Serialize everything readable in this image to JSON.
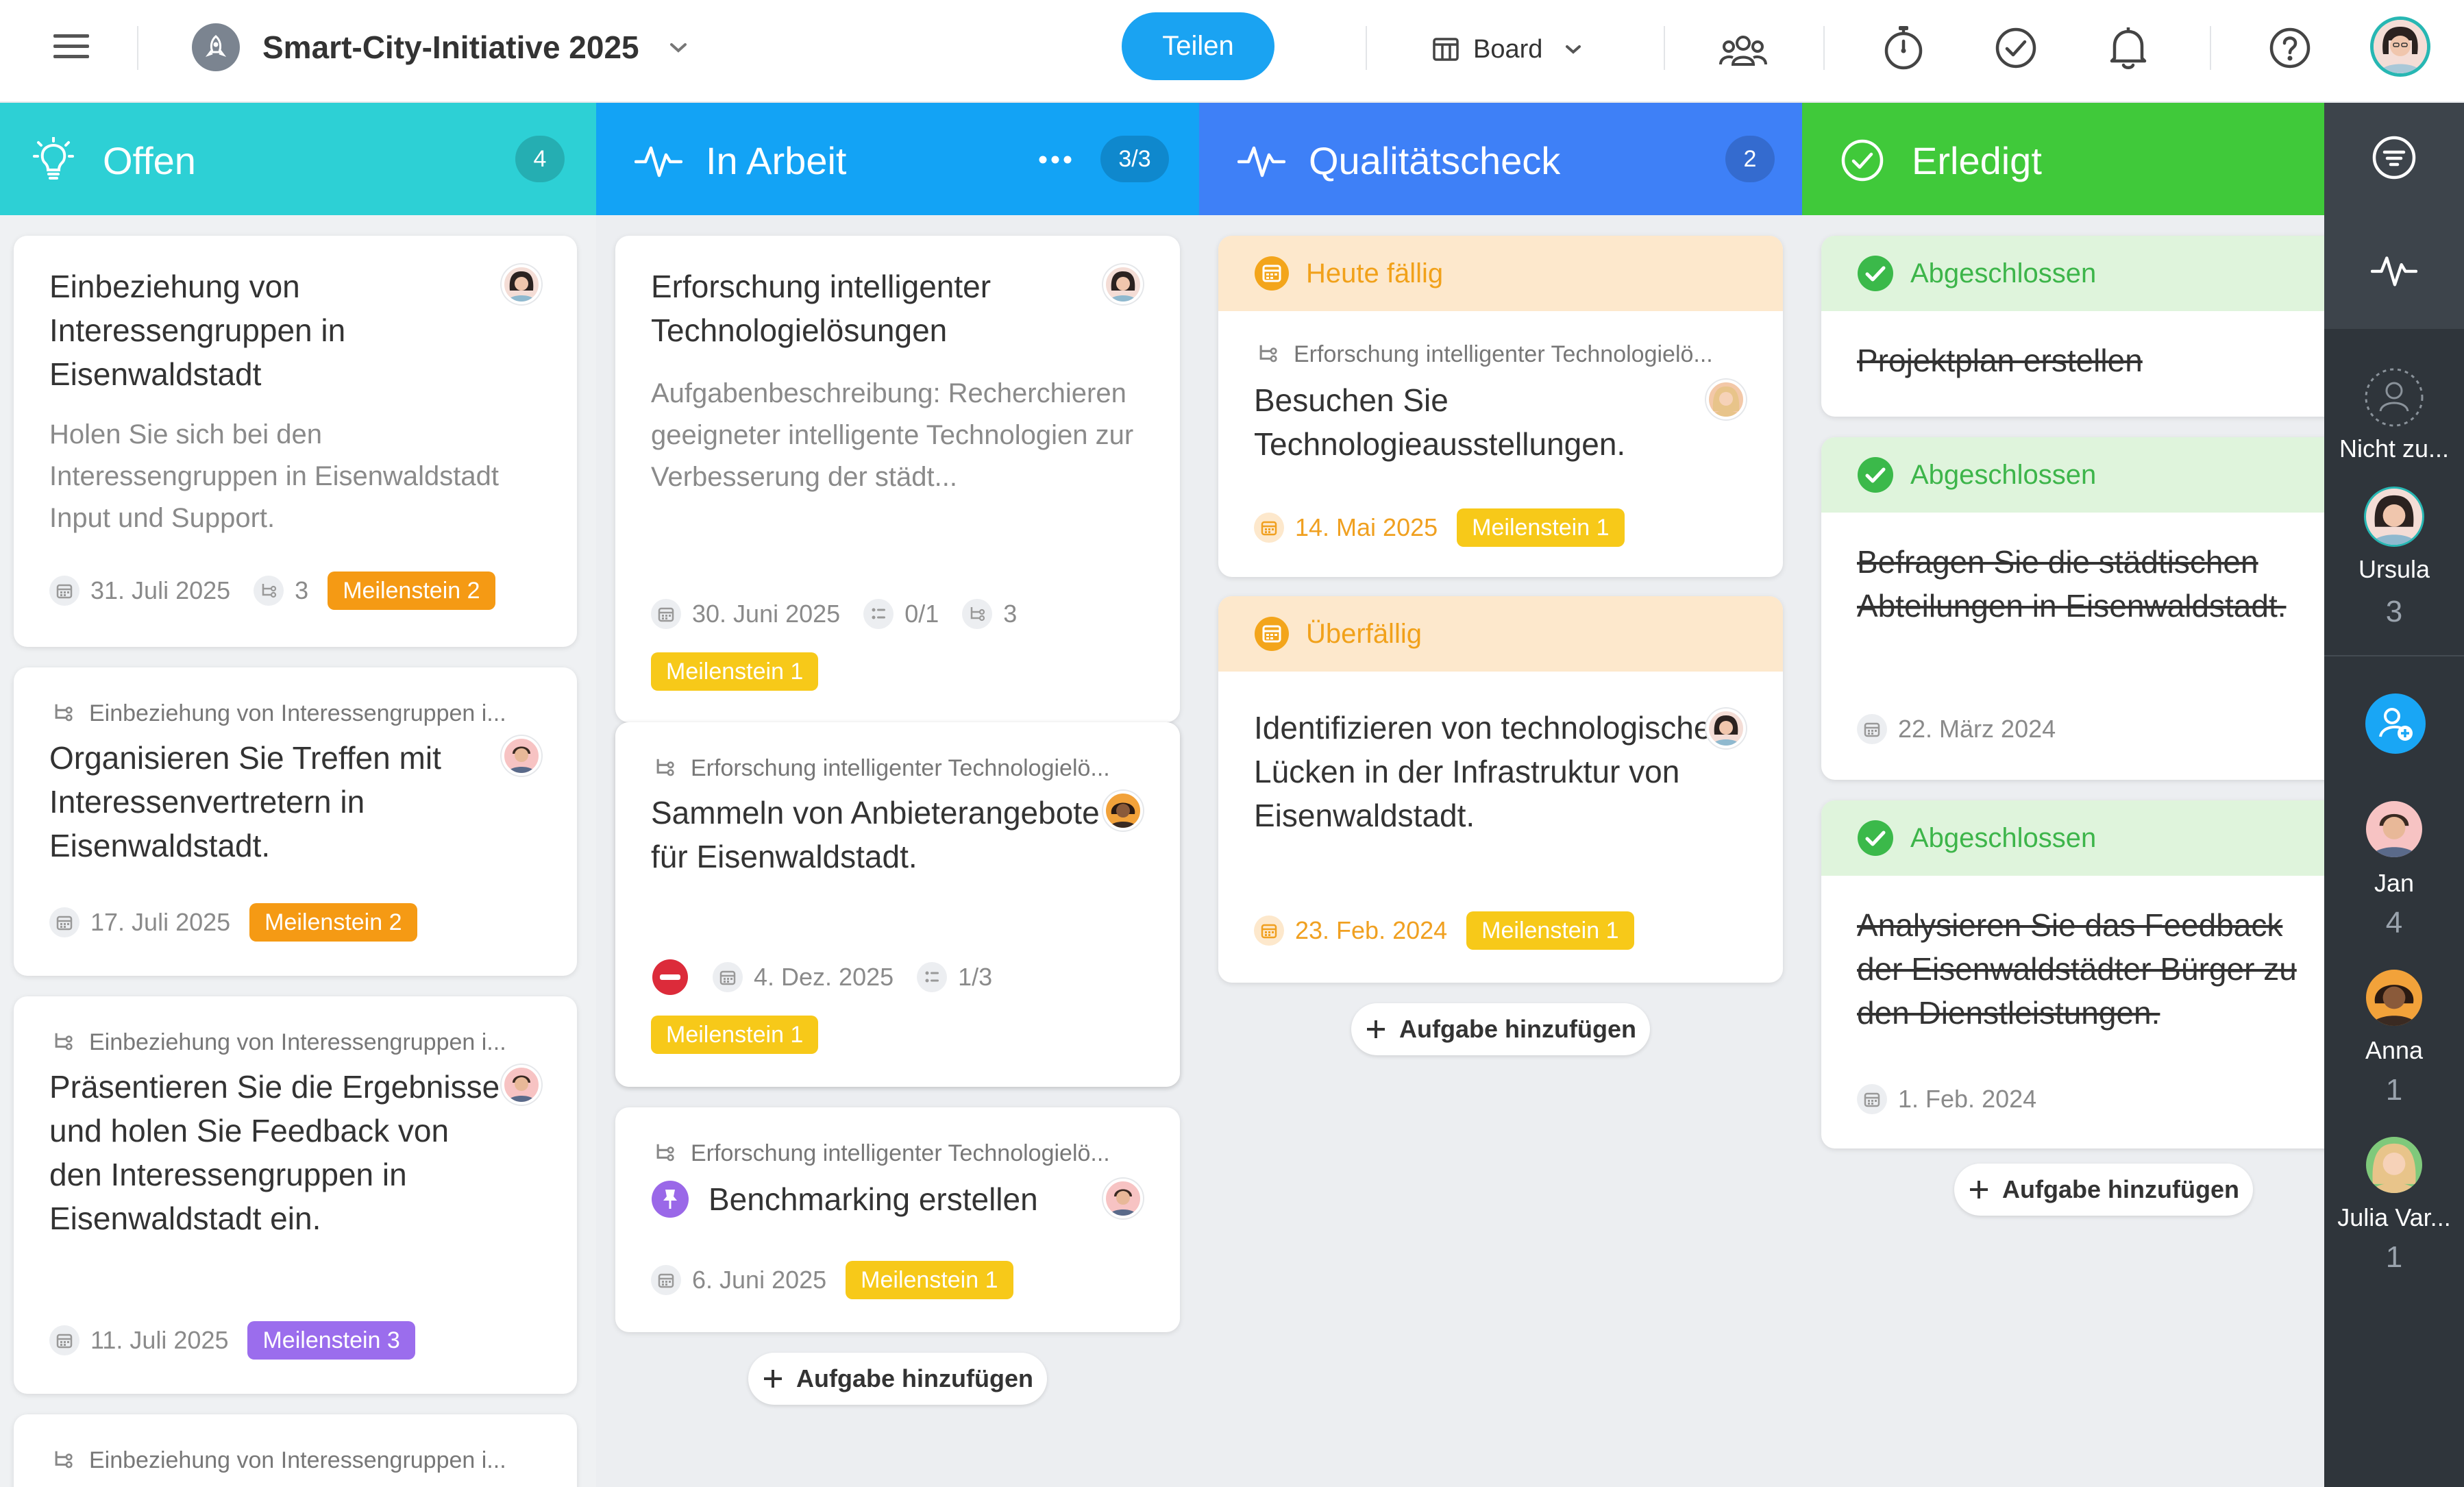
{
  "header": {
    "project_title": "Smart-City-Initiative 2025",
    "share_label": "Teilen",
    "view_label": "Board",
    "icons": [
      "menu-icon",
      "project-rocket-icon",
      "chevron-down-icon",
      "board-view-icon",
      "team-icon",
      "timer-icon",
      "check-circle-icon",
      "bell-icon",
      "help-icon"
    ]
  },
  "columns": [
    {
      "title": "Offen",
      "count": "4",
      "color": "#2cd0d5"
    },
    {
      "title": "In Arbeit",
      "count": "3/3",
      "color": "#12a3f5"
    },
    {
      "title": "Qualitätscheck",
      "count": "2",
      "color": "#3d80f7"
    },
    {
      "title": "Erledigt",
      "color": "#3fc93a"
    }
  ],
  "offen": {
    "c1": {
      "title": "Einbeziehung von Interessengruppen in Eisenwaldstadt",
      "desc": "Holen Sie sich bei den Interessengruppen in Eisenwaldstadt Input und Support.",
      "date": "31. Juli 2025",
      "subtasks": "3",
      "milestone": "Meilenstein 2"
    },
    "c2": {
      "parent": "Einbeziehung von Interessengruppen i...",
      "title": "Organisieren Sie Treffen mit Interessenvertretern in Eisenwaldstadt.",
      "date": "17. Juli 2025",
      "milestone": "Meilenstein 2"
    },
    "c3": {
      "parent": "Einbeziehung von Interessengruppen i...",
      "title": "Präsentieren Sie die Ergebnisse und holen Sie Feedback von den Interessengruppen in Eisenwaldstadt ein.",
      "date": "11. Juli 2025",
      "milestone": "Meilenstein 3"
    },
    "c4": {
      "parent": "Einbeziehung von Interessengruppen i..."
    }
  },
  "arbeit": {
    "c1": {
      "title": "Erforschung intelligenter Technologielösungen",
      "desc": "Aufgabenbeschreibung: Recherchieren geeigneter intelligente Technologien zur Verbesserung der städt...",
      "date": "30. Juni 2025",
      "checklist": "0/1",
      "subtasks": "3",
      "milestone": "Meilenstein 1"
    },
    "c2": {
      "parent": "Erforschung intelligenter Technologielö...",
      "title": "Sammeln von Anbieterangebote für Eisenwaldstadt.",
      "date": "4. Dez. 2025",
      "checklist": "1/3",
      "milestone": "Meilenstein 1"
    },
    "c3": {
      "parent": "Erforschung intelligenter Technologielö...",
      "title": "Benchmarking erstellen",
      "date": "6. Juni 2025",
      "milestone": "Meilenstein 1"
    },
    "add": "Aufgabe hinzufügen"
  },
  "quali": {
    "c1": {
      "status": "Heute fällig",
      "parent": "Erforschung intelligenter Technologielö...",
      "title": "Besuchen Sie Technologieausstellungen.",
      "date": "14. Mai 2025",
      "milestone": "Meilenstein 1"
    },
    "c2": {
      "status": "Überfällig",
      "title": "Identifizieren von technologische Lücken in der Infrastruktur von Eisenwaldstadt.",
      "date": "23. Feb. 2024",
      "milestone": "Meilenstein 1"
    },
    "add": "Aufgabe hinzufügen"
  },
  "erledigt": {
    "c1": {
      "status": "Abgeschlossen",
      "title": "Projektplan erstellen"
    },
    "c2": {
      "status": "Abgeschlossen",
      "title": "Befragen Sie die städtischen Abteilungen in Eisenwaldstadt.",
      "date": "22. März 2024"
    },
    "c3": {
      "status": "Abgeschlossen",
      "title": "Analysieren Sie das Feedback der Eisenwaldstädter Bürger zu den Dienstleistungen.",
      "date": "1. Feb. 2024"
    },
    "add": "Aufgabe hinzufügen"
  },
  "sidebar": {
    "unassigned": {
      "name": "Nicht zu..."
    },
    "people": [
      {
        "name": "Ursula",
        "count": "3"
      },
      {
        "name": "Jan",
        "count": "4"
      },
      {
        "name": "Anna",
        "count": "1"
      },
      {
        "name": "Julia Var...",
        "count": "1"
      }
    ]
  }
}
